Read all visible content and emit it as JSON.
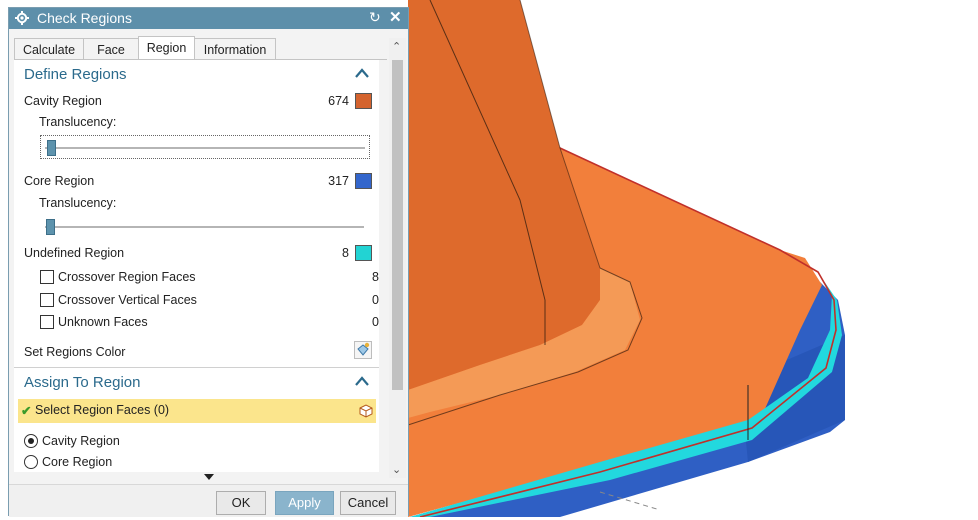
{
  "dialog": {
    "title": "Check Regions",
    "reset_icon": "reset-icon",
    "close_icon": "close-icon",
    "gear_icon": "gear-icon"
  },
  "tabs": [
    {
      "label": "Calculate",
      "active": false
    },
    {
      "label": "Face",
      "active": false
    },
    {
      "label": "Region",
      "active": true
    },
    {
      "label": "Information",
      "active": false
    }
  ],
  "define_regions": {
    "header": "Define Regions",
    "cavity": {
      "label": "Cavity Region",
      "count": "674",
      "color": "#d4632e"
    },
    "cavity_translucency": {
      "label": "Translucency:",
      "level": 0.0
    },
    "core": {
      "label": "Core Region",
      "count": "317",
      "color": "#3366cc"
    },
    "core_translucency": {
      "label": "Translucency:",
      "level": 0.0
    },
    "undefined": {
      "label": "Undefined Region",
      "count": "8",
      "color": "#22d3d3"
    },
    "crossover_region_faces": {
      "label": "Crossover Region Faces",
      "count": "8",
      "checked": false
    },
    "crossover_vertical_faces": {
      "label": "Crossover Vertical Faces",
      "count": "0",
      "checked": false
    },
    "unknown_faces": {
      "label": "Unknown Faces",
      "count": "0",
      "checked": false
    },
    "set_color": {
      "label": "Set Regions Color",
      "icon": "paint-bucket-icon"
    }
  },
  "assign_region": {
    "header": "Assign To Region",
    "select_faces": "Select Region Faces (0)",
    "select_icon": "face-select-icon",
    "check_icon": "checkmark-icon",
    "options": [
      {
        "label": "Cavity Region",
        "selected": true
      },
      {
        "label": "Core Region",
        "selected": false
      }
    ]
  },
  "buttons": {
    "ok": "OK",
    "apply": "Apply",
    "cancel": "Cancel"
  },
  "colors": {
    "header_blue": "#5d8faa",
    "section_text": "#2b6a8c",
    "cavity_orange": "#f07c3c",
    "core_blue": "#3162c8",
    "highlight_yellow": "#fbe58c"
  }
}
